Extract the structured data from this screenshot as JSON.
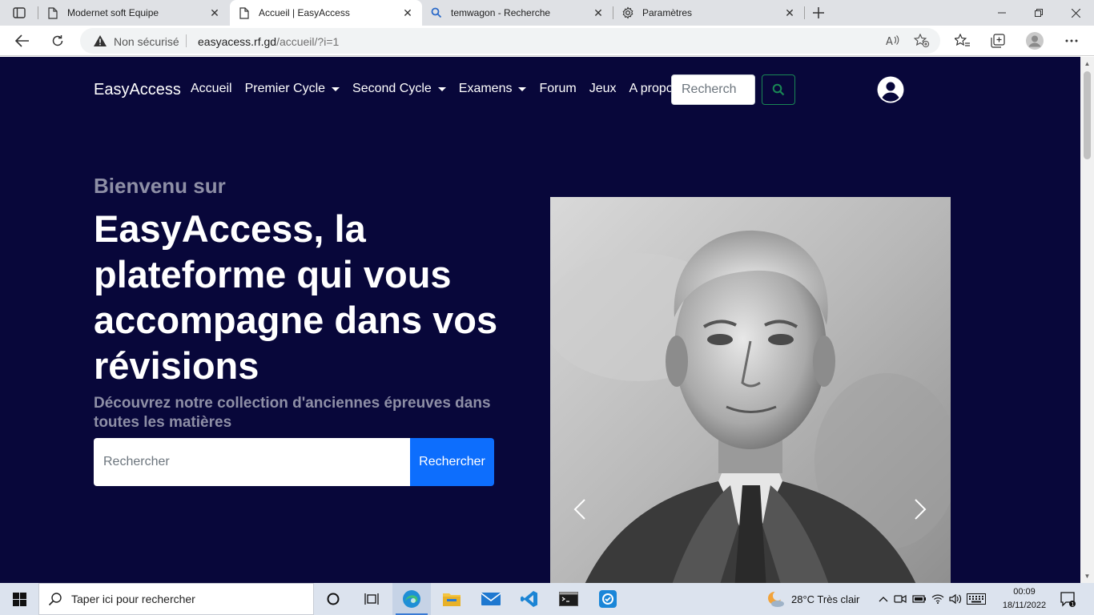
{
  "browser": {
    "tabs": [
      {
        "title": "Modernet soft Equipe",
        "icon": "page-icon",
        "active": false
      },
      {
        "title": "Accueil | EasyAccess",
        "icon": "page-icon",
        "active": true
      },
      {
        "title": "temwagon - Recherche",
        "icon": "search-icon",
        "active": false
      },
      {
        "title": "Paramètres",
        "icon": "gear-icon",
        "active": false
      }
    ],
    "close_glyph": "✕",
    "new_tab_icon": "plus-icon",
    "security_status": "Non sécurisé",
    "url_domain": "easyacess.rf.gd",
    "url_path": "/accueil/?i=1"
  },
  "site": {
    "brand": "EasyAccess",
    "nav": [
      {
        "label": "Accueil",
        "dropdown": false
      },
      {
        "label": "Premier Cycle",
        "dropdown": true
      },
      {
        "label": "Second Cycle",
        "dropdown": true
      },
      {
        "label": "Examens",
        "dropdown": true
      },
      {
        "label": "Forum",
        "dropdown": false
      },
      {
        "label": "Jeux",
        "dropdown": false
      },
      {
        "label": "A propos",
        "dropdown": false
      }
    ],
    "nav_search_placeholder": "Recherch",
    "colors": {
      "background": "#08073a",
      "muted_text": "#8e8fa6",
      "primary": "#0d6efd",
      "success_outline": "#198754"
    }
  },
  "hero": {
    "pretitle": "Bienvenu sur",
    "title": "EasyAccess, la plateforme qui vous accompagne dans vos révisions",
    "subtitle": "Découvrez notre collection d'anciennes épreuves dans toutes les matières",
    "search_placeholder": "Rechercher",
    "search_button": "Rechercher"
  },
  "carousel": {
    "image": "black-and-white portrait photograph",
    "prev_icon": "chevron-left-icon",
    "next_icon": "chevron-right-icon"
  },
  "taskbar": {
    "search_placeholder": "Taper ici pour rechercher",
    "weather": "28°C  Très clair",
    "time": "00:09",
    "date": "18/11/2022"
  }
}
